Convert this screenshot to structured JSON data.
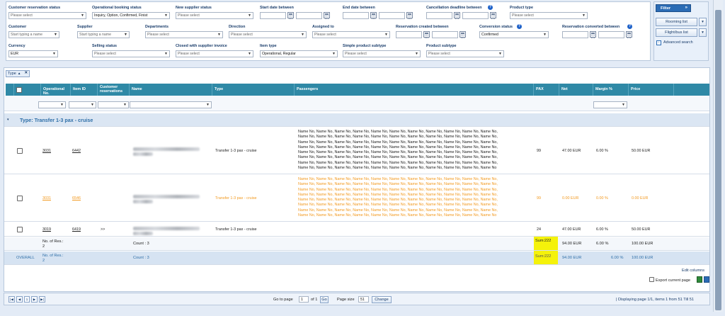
{
  "filters": {
    "customer_reservation_status": {
      "label": "Customer reservation status",
      "value": "Please select"
    },
    "operational_booking_status": {
      "label": "Operational booking status",
      "value": "Inquiry, Option, Confirmed, Finist"
    },
    "new_supplier_status": {
      "label": "New supplier status",
      "value": "Please select"
    },
    "start_date_between": {
      "label": "Start date between"
    },
    "end_date_between": {
      "label": "End date between"
    },
    "cancellation_deadline_between": {
      "label": "Cancellation deadline between"
    },
    "product_type": {
      "label": "Product type",
      "value": "Please select"
    },
    "customer": {
      "label": "Customer",
      "placeholder": "Start typing a name"
    },
    "supplier": {
      "label": "Supplier",
      "placeholder": "Start typing a name"
    },
    "departments": {
      "label": "Departments",
      "value": "Please select"
    },
    "direction": {
      "label": "Direction",
      "value": "Please select"
    },
    "assigned_to": {
      "label": "Assigned to",
      "value": "Please select"
    },
    "reservation_created_between": {
      "label": "Reservation created between"
    },
    "conversion_status": {
      "label": "Conversion status",
      "value": "Confirmed"
    },
    "reservation_converted_between": {
      "label": "Reservation converted between"
    },
    "currency": {
      "label": "Currency",
      "value": "EUR"
    },
    "selling_status": {
      "label": "Selling status",
      "value": "Please select"
    },
    "closed_with_supplier_invoice": {
      "label": "Closed with supplier invoice",
      "value": "Please select"
    },
    "item_type": {
      "label": "Item type",
      "value": "Operational, Regular"
    },
    "simple_product_subtype": {
      "label": "Simple product subtype",
      "value": "Please select"
    },
    "product_subtype": {
      "label": "Product subtype",
      "value": "Please select"
    }
  },
  "side": {
    "filter": "Filter",
    "rooming_list": "Rooming list",
    "flight_bus_list": "Flight/bus list",
    "advanced_search": "Advanced search"
  },
  "group_chip": "Type",
  "columns": {
    "op_no": "Operational No.",
    "item_id": "Item ID",
    "cust_res": "Customer reservations",
    "name": "Name",
    "type": "Type",
    "passengers": "Passengers",
    "pax": "PAX",
    "net": "Net",
    "margin": "Margin %",
    "price": "Price"
  },
  "group_header": "Type: Transfer 1-3 pax - cruise",
  "rows": [
    {
      "op_no": "3031",
      "item_id": "6442",
      "cust": "",
      "type": "Transfer 1-3 pax - cruise",
      "pax": "99",
      "net": "47.00 EUR",
      "margin": "6.00 %",
      "price": "50.00 EUR"
    },
    {
      "op_no": "3031",
      "item_id": "6546",
      "cust": "",
      "type": "Transfer 1-3 pax - cruise",
      "pax": "99",
      "net": "0.00 EUR",
      "margin": "0.00 %",
      "price": "0.00 EUR"
    },
    {
      "op_no": "3019",
      "item_id": "6419",
      "cust": ">>",
      "type": "Transfer 1-3 pax - cruise",
      "pax": "24",
      "net": "47.00 EUR",
      "margin": "6.00 %",
      "price": "50.00 EUR"
    }
  ],
  "passenger_line": "Name No, Name No, Name No, Name No, Name No, Name No, Name No, Name No, Name No, Name No, Name No,",
  "passenger_last": "Name No, Name No, Name No, Name No, Name No, Name No, Name No, Name No, Name No, Name No, Name No",
  "summary": {
    "no_of_res": "No. of Res.:",
    "no_of_res_val": "2",
    "count": "Count : 3",
    "sum": "Sum:222",
    "net": "94.00 EUR",
    "margin": "6.00 %",
    "price": "100.00 EUR"
  },
  "overall": {
    "label": "OVERALL",
    "no_of_res": "No. of Res.:",
    "no_of_res_val": "2",
    "count": "Count : 3",
    "sum": "Sum:222",
    "net": "94.00 EUR",
    "margin": "6.00 %",
    "price": "100.00 EUR"
  },
  "edit_columns": "Edit columns",
  "export": "Export current page",
  "pager": {
    "page": "1",
    "go_to_page": "Go to page",
    "of": "of 1",
    "go": "Go",
    "page_size_label": "Page size",
    "page_size": "51",
    "change": "Change",
    "info": "| Displaying page  1/1,  items  1  from  51  Till  51"
  }
}
